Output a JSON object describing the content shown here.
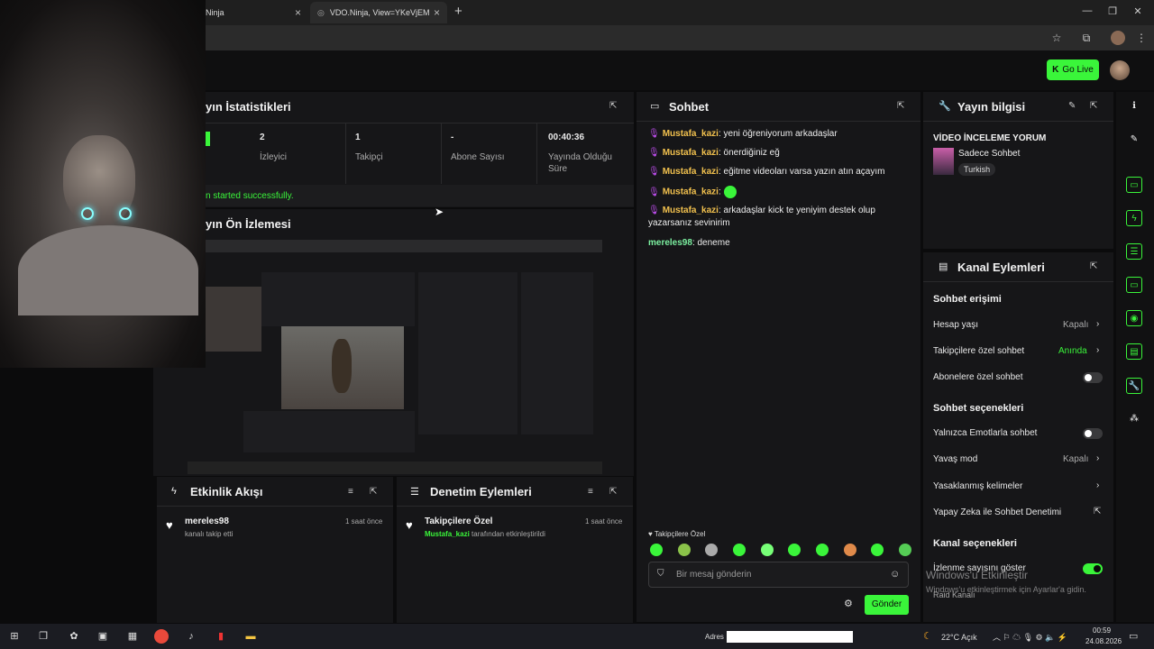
{
  "browser": {
    "tabs": [
      {
        "title": "Ninja"
      },
      {
        "title": "VDO.Ninja, View=YKeVjEM"
      }
    ]
  },
  "header": {
    "go_live_label": "Go Live"
  },
  "stats": {
    "title": "yın İstatistikleri",
    "items": [
      {
        "value": "2",
        "label": "İzleyici"
      },
      {
        "value": "1",
        "label": "Takipçi"
      },
      {
        "value": "-",
        "label": "Abone Sayısı"
      },
      {
        "value": "00:40:36",
        "label": "Yayında Olduğu Süre"
      }
    ],
    "status": "n started successfully."
  },
  "preview": {
    "title": "yın Ön İzlemesi"
  },
  "activity": {
    "title": "Etkinlik Akışı",
    "items": [
      {
        "user": "mereles98",
        "desc": "kanalı takip etti",
        "time": "1 saat önce"
      }
    ]
  },
  "moderation": {
    "title": "Denetim Eylemleri",
    "items": [
      {
        "action": "Takipçilere Özel",
        "user": "Mustafa_kazi",
        "desc": "tarafından etkinleştirildi",
        "time": "1 saat önce"
      }
    ]
  },
  "chat": {
    "title": "Sohbet",
    "messages": [
      {
        "user": "Mustafa_kazi",
        "text": ": yeni öğreniyorum arkadaşlar"
      },
      {
        "user": "Mustafa_kazi",
        "text": ": önerdiğiniz eğ"
      },
      {
        "user": "Mustafa_kazi",
        "text": ": eğitme videoları varsa yazın atın açayım"
      },
      {
        "user": "Mustafa_kazi",
        "text": ":"
      },
      {
        "user": "Mustafa_kazi",
        "text": ": arkadaşlar kick te yeniyim destek olup yazarsanız sevinirim"
      },
      {
        "user": "mereles98",
        "text": ": deneme"
      }
    ],
    "mode_label": "Takipçilere Özel",
    "input_placeholder": "Bir mesaj gönderin",
    "send_label": "Gönder"
  },
  "info": {
    "title": "Yayın bilgisi",
    "stream_title": "VİDEO İNCELEME YORUM",
    "category": "Sadece Sohbet",
    "language": "Turkish"
  },
  "channel": {
    "title": "Kanal Eylemleri",
    "sections": {
      "access": "Sohbet erişimi",
      "options": "Sohbet seçenekleri",
      "channel": "Kanal seçenekleri"
    },
    "rows": {
      "account_age": {
        "label": "Hesap yaşı",
        "value": "Kapalı"
      },
      "followers_only": {
        "label": "Takipçilere özel sohbet",
        "value": "Anında"
      },
      "subs_only": {
        "label": "Abonelere özel sohbet"
      },
      "emote_only": {
        "label": "Yalnızca Emotlarla sohbet"
      },
      "slow_mode": {
        "label": "Yavaş mod",
        "value": "Kapalı"
      },
      "banned_words": {
        "label": "Yasaklanmış kelimeler"
      },
      "ai_moderation": {
        "label": "Yapay Zeka ile Sohbet Denetimi"
      },
      "show_viewers": {
        "label": "İzlenme sayısını göster"
      },
      "raid": {
        "label": "Raid Kanalı"
      }
    }
  },
  "os": {
    "watermark_title": "Windows'u Etkinleştir",
    "watermark_sub": "Windows'u etkinleştirmek için Ayarlar'a gidin.",
    "address_label": "Adres",
    "weather": "22°C  Açık",
    "time": "00:59",
    "date": "24.08.2026",
    "accent": "#3af53a"
  }
}
